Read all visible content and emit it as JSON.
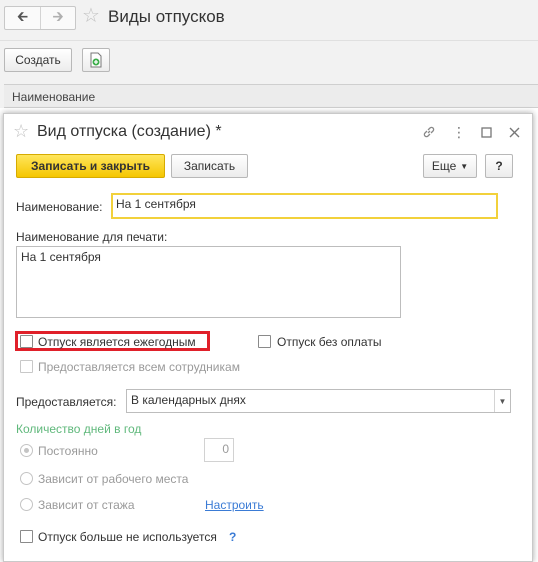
{
  "background": {
    "title": "Виды отпусков",
    "create_label": "Создать",
    "column_header": "Наименование"
  },
  "dialog": {
    "title": "Вид отпуска (создание) *",
    "buttons": {
      "save_close": "Записать и закрыть",
      "save": "Записать",
      "more": "Еще",
      "help": "?"
    },
    "name_label": "Наименование:",
    "name_value": "На 1 сентября",
    "print_name_label": "Наименование для печати:",
    "print_name_value": "На 1 сентября",
    "annual_label": "Отпуск является ежегодным",
    "unpaid_label": "Отпуск без оплаты",
    "all_employees_label": "Предоставляется всем сотрудникам",
    "provided_label": "Предоставляется:",
    "provided_value": "В календарных днях",
    "days_group_label": "Количество дней в год",
    "radio_constant": "Постоянно",
    "constant_value": "0",
    "radio_workplace": "Зависит от рабочего места",
    "radio_seniority": "Зависит от стажа",
    "configure_link": "Настроить",
    "not_used_label": "Отпуск больше не используется",
    "not_used_help": "?"
  }
}
